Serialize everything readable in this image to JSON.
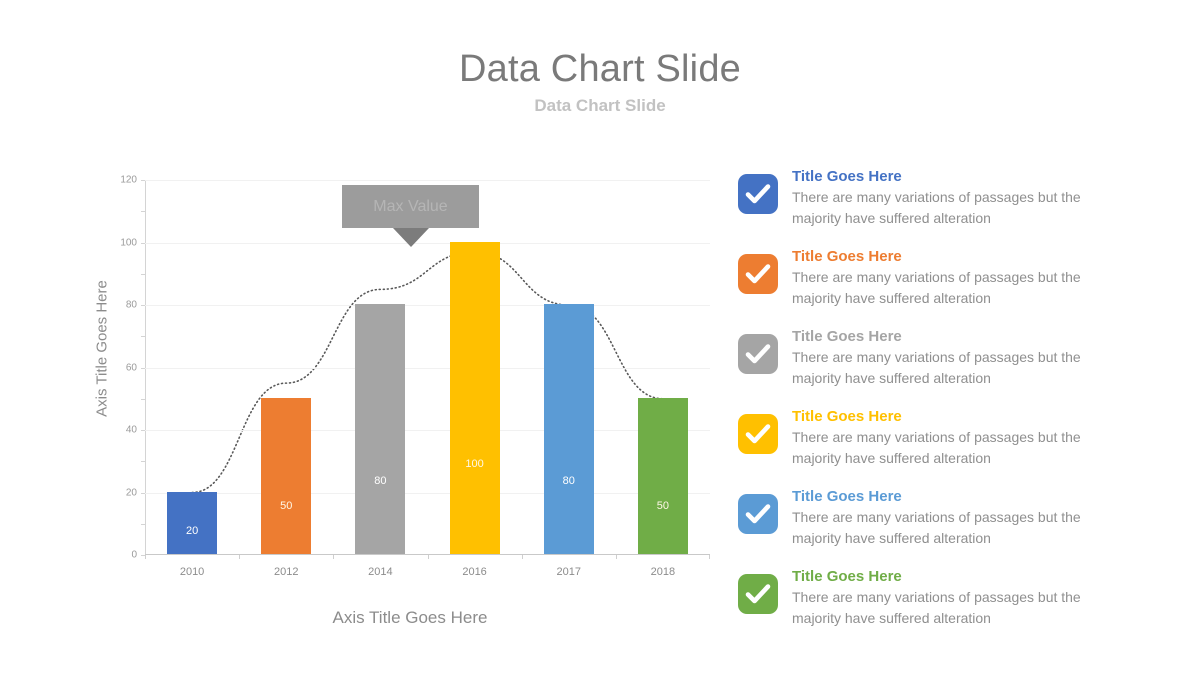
{
  "header": {
    "title": "Data Chart Slide",
    "subtitle": "Data Chart Slide"
  },
  "callout": {
    "label": "Max Value",
    "color": "#9c9c9c"
  },
  "chart_data": {
    "type": "bar",
    "title": "",
    "xlabel": "Axis Title Goes Here",
    "ylabel": "Axis Title Goes Here",
    "categories": [
      "2010",
      "2012",
      "2014",
      "2016",
      "2017",
      "2018"
    ],
    "values": [
      20,
      50,
      80,
      100,
      80,
      50
    ],
    "bar_colors": [
      "#4472C4",
      "#ED7D31",
      "#A5A5A5",
      "#FFC000",
      "#5B9BD5",
      "#70AD47"
    ],
    "data_labels": [
      "20",
      "50",
      "80",
      "100",
      "80",
      "50"
    ],
    "ylim": [
      0,
      120
    ],
    "yticks": [
      0,
      20,
      40,
      60,
      80,
      100,
      120
    ],
    "ytick_labels": [
      "0",
      "20",
      "40",
      "60",
      "80",
      "100",
      "120"
    ],
    "minor_tick_step": 10,
    "grid": true,
    "legend_position": "right",
    "annotations": [
      {
        "text": "Max Value",
        "target_category": "2016",
        "target_value": 100
      }
    ],
    "series": [
      {
        "name": "Trend",
        "type": "line",
        "style": "dotted",
        "color": "#595959",
        "values": [
          20,
          55,
          85,
          97,
          80,
          50
        ]
      }
    ]
  },
  "legend": {
    "items": [
      {
        "icon": "check-square-icon",
        "color": "#4472C4",
        "title": "Title Goes Here",
        "description": "There are many variations of passages but the majority have  suffered alteration"
      },
      {
        "icon": "check-square-icon",
        "color": "#ED7D31",
        "title": "Title Goes Here",
        "description": "There are many variations of passages but the majority have  suffered alteration"
      },
      {
        "icon": "check-square-icon",
        "color": "#A5A5A5",
        "title": "Title Goes Here",
        "description": "There are many variations of passages but the majority have  suffered alteration"
      },
      {
        "icon": "check-square-icon",
        "color": "#FFC000",
        "title": "Title Goes Here",
        "description": "There are many variations of passages but the majority have  suffered alteration"
      },
      {
        "icon": "check-square-icon",
        "color": "#5B9BD5",
        "title": "Title Goes Here",
        "description": "There are many variations of passages but the majority have  suffered alteration"
      },
      {
        "icon": "check-square-icon",
        "color": "#70AD47",
        "title": "Title Goes Here",
        "description": "There are many variations of passages but the majority have  suffered alteration"
      }
    ]
  }
}
